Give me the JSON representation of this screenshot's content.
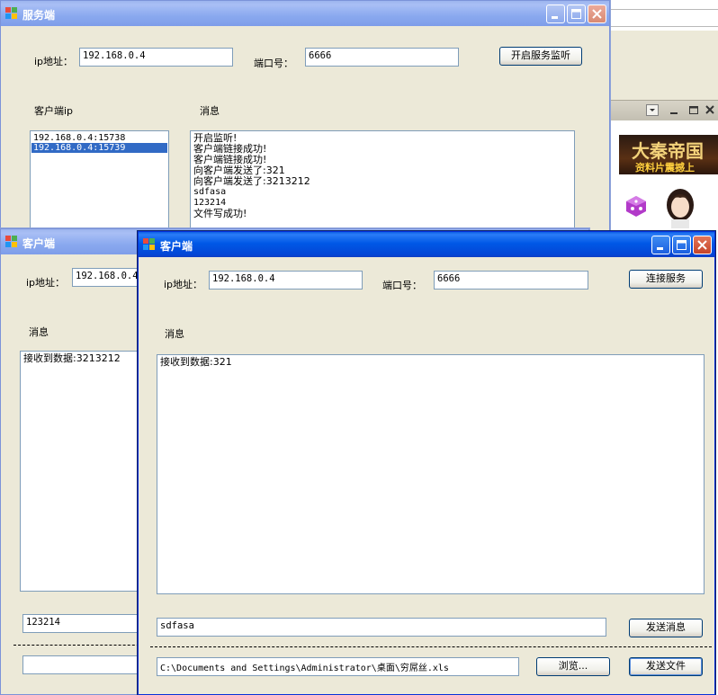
{
  "server_window": {
    "title": "服务端",
    "ip_label": "ip地址：",
    "ip_value": "192.168.0.4",
    "port_label": "端口号：",
    "port_value": "6666",
    "listen_button": "开启服务监听",
    "client_ip_label": "客户端ip",
    "message_label": "消息",
    "clients": [
      "192.168.0.4:15738",
      "192.168.0.4:15739"
    ],
    "selected_client_index": 1,
    "messages": [
      "开启监听!",
      "客户端链接成功!",
      "客户端链接成功!",
      "向客户端发送了:321",
      "向客户端发送了:3213212",
      "sdfasa",
      "123214",
      "文件写成功!"
    ]
  },
  "client_window_back": {
    "title": "客户端",
    "ip_label": "ip地址：",
    "ip_value": "192.168.0.4",
    "message_label": "消息",
    "received": "接收到数据:3213212",
    "send_value": "123214"
  },
  "client_window_front": {
    "title": "客户端",
    "ip_label": "ip地址：",
    "ip_value": "192.168.0.4",
    "port_label": "端口号：",
    "port_value": "6666",
    "connect_button": "连接服务",
    "message_label": "消息",
    "received": "接收到数据:321",
    "send_value": "sdfasa",
    "send_button": "发送消息",
    "file_path": "C:\\Documents and Settings\\Administrator\\桌面\\穷屌丝.xls",
    "browse_button": "浏览...",
    "send_file_button": "发送文件"
  },
  "background_app": {
    "banner_text": "大秦帝国",
    "banner_subtext": "资料片震撼上"
  },
  "colors": {
    "xp_blue": "#0058e6",
    "dialog_bg": "#ece9d8",
    "selection": "#316ac5",
    "close_red": "#c5452a"
  }
}
